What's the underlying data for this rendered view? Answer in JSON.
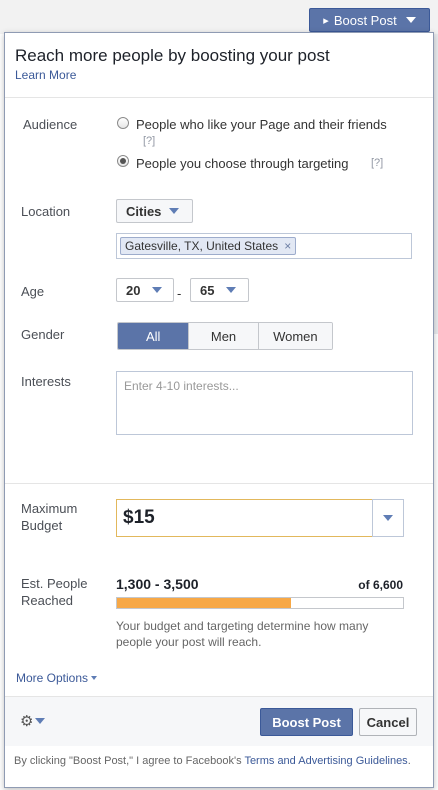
{
  "top_bar": {
    "boost_button": "Boost Post"
  },
  "dialog": {
    "title": "Reach more people by boosting your post",
    "learn_more": "Learn More",
    "audience": {
      "label": "Audience",
      "options": [
        {
          "label": "People who like your Page and their friends",
          "help": "[?]",
          "selected": false
        },
        {
          "label": "People you choose through targeting",
          "help": "[?]",
          "selected": true
        }
      ]
    },
    "location": {
      "label": "Location",
      "type_dropdown": "Cities",
      "tokens": [
        "Gatesville, TX, United States"
      ],
      "token_remove": "×"
    },
    "age": {
      "label": "Age",
      "min": "20",
      "separator": "-",
      "max": "65"
    },
    "gender": {
      "label": "Gender",
      "options": [
        "All",
        "Men",
        "Women"
      ],
      "selected": "All"
    },
    "interests": {
      "label": "Interests",
      "placeholder": "Enter 4-10 interests..."
    },
    "budget": {
      "label_line1": "Maximum",
      "label_line2": "Budget",
      "value": "$15"
    },
    "reach": {
      "label_line1": "Est. People",
      "label_line2": "Reached",
      "range": "1,300 - 3,500",
      "of_total": "of 6,600",
      "progress_fraction": 0.61,
      "note": "Your budget and targeting determine how many people your post will reach."
    },
    "more_options": "More Options",
    "footer": {
      "boost_button": "Boost Post",
      "cancel_button": "Cancel",
      "legal_prefix": "By clicking \"Boost Post,\" I agree to Facebook's ",
      "legal_link": "Terms and Advertising Guidelines",
      "legal_suffix": "."
    }
  },
  "colors": {
    "primary": "#5b74a8",
    "link": "#3b5998",
    "progress": "#f7a846",
    "budget_border": "#e2b85c"
  }
}
